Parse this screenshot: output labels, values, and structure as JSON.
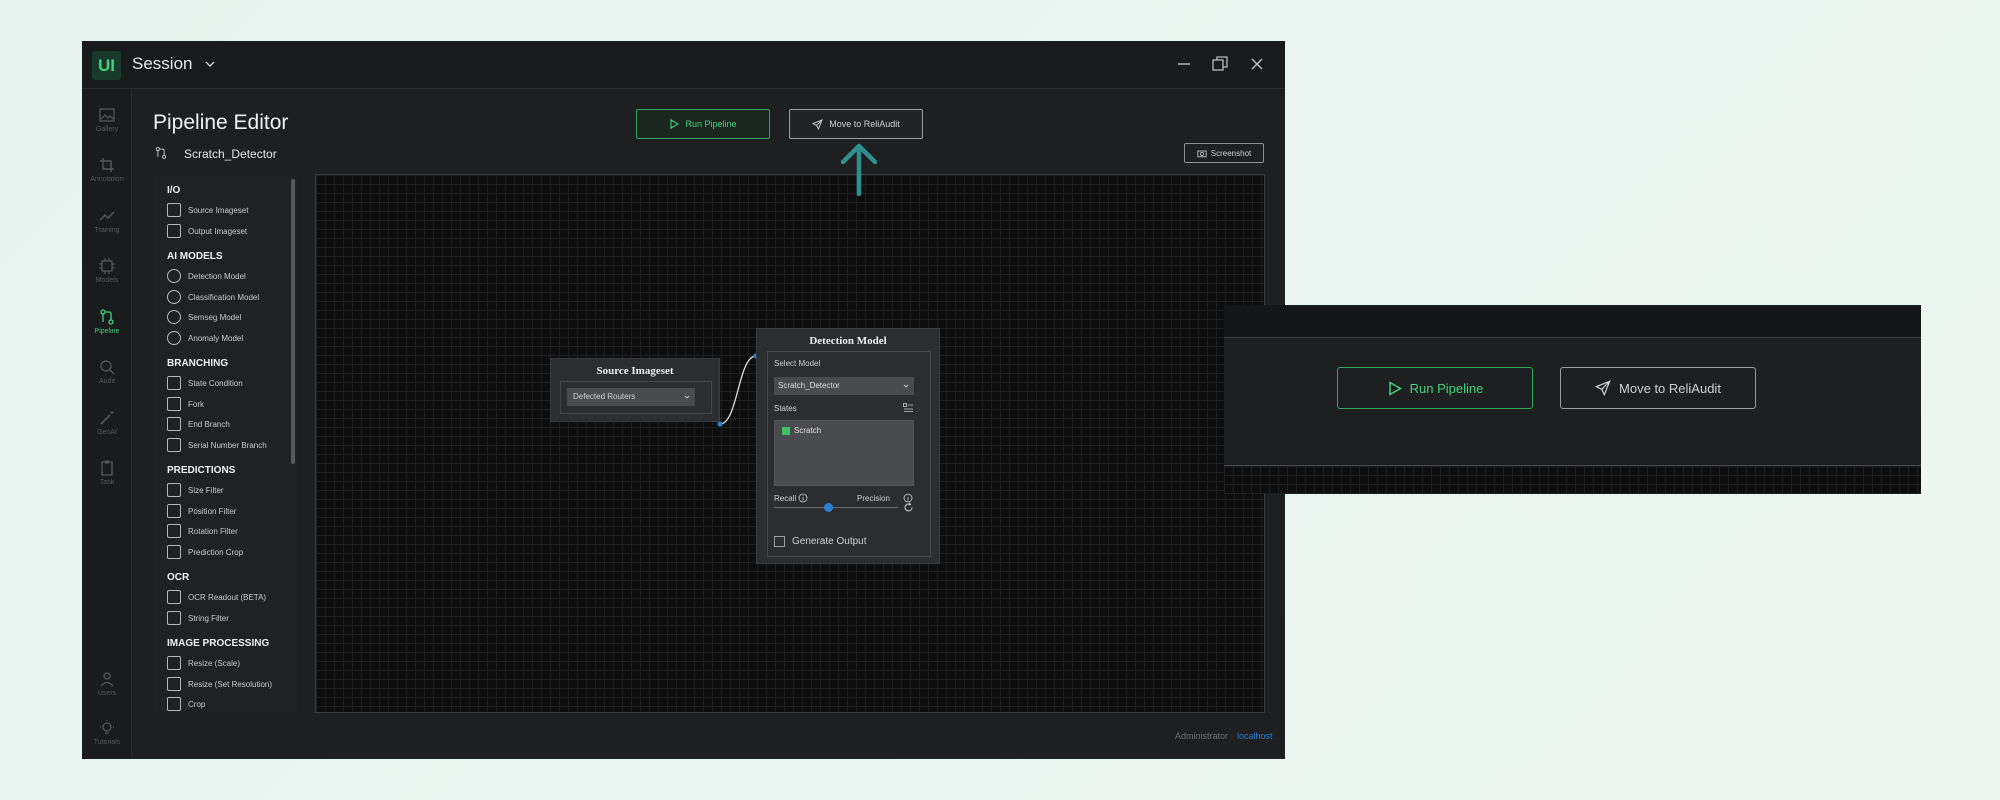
{
  "window": {
    "app_logo": "UI",
    "session_title": "Session"
  },
  "sidebar": {
    "items": [
      {
        "label": "Gallery",
        "icon": "image-icon"
      },
      {
        "label": "Annotation",
        "icon": "crop-icon"
      },
      {
        "label": "Training",
        "icon": "trend-icon"
      },
      {
        "label": "Models",
        "icon": "chip-icon"
      },
      {
        "label": "Pipeline",
        "icon": "pipeline-icon",
        "active": true
      },
      {
        "label": "Audit",
        "icon": "audit-icon"
      },
      {
        "label": "GenAI",
        "icon": "wand-icon"
      },
      {
        "label": "Task",
        "icon": "clipboard-icon"
      },
      {
        "label": "Users",
        "icon": "user-icon"
      },
      {
        "label": "Tutorials",
        "icon": "bulb-icon"
      }
    ]
  },
  "header": {
    "page_title": "Pipeline Editor",
    "pipeline_name": "Scratch_Detector",
    "run_label": "Run Pipeline",
    "move_label": "Move to ReliAudit",
    "screenshot_label": "Screenshot"
  },
  "palette": {
    "sections": [
      {
        "title": "I/O",
        "items": [
          "Source Imageset",
          "Output Imageset"
        ]
      },
      {
        "title": "AI MODELS",
        "items": [
          "Detection Model",
          "Classification Model",
          "Semseg Model",
          "Anomaly Model"
        ]
      },
      {
        "title": "BRANCHING",
        "items": [
          "State Condition",
          "Fork",
          "End Branch",
          "Serial Number Branch"
        ]
      },
      {
        "title": "PREDICTIONS",
        "items": [
          "Size Filter",
          "Position Filter",
          "Rotation Filter",
          "Prediction Crop"
        ]
      },
      {
        "title": "OCR",
        "items": [
          "OCR Readout (BETA)",
          "String Filter"
        ]
      },
      {
        "title": "IMAGE PROCESSING",
        "items": [
          "Resize (Scale)",
          "Resize (Set Resolution)",
          "Crop"
        ]
      }
    ]
  },
  "nodes": {
    "source": {
      "title": "Source Imageset",
      "selected": "Defected Routers"
    },
    "detection": {
      "title": "Detection Model",
      "select_label": "Select Model",
      "selected_model": "Scratch_Detector",
      "states_label": "States",
      "states": [
        "Scratch"
      ],
      "recall_label": "Recall",
      "precision_label": "Precision",
      "slider_value": 0.5,
      "generate_label": "Generate Output",
      "generate_checked": false
    }
  },
  "status": {
    "user": "Administrator",
    "host": "localhost"
  },
  "colors": {
    "accent_green": "#3fd37b",
    "link_blue": "#2a7fd1",
    "arrow_teal": "#2f8f8f"
  }
}
